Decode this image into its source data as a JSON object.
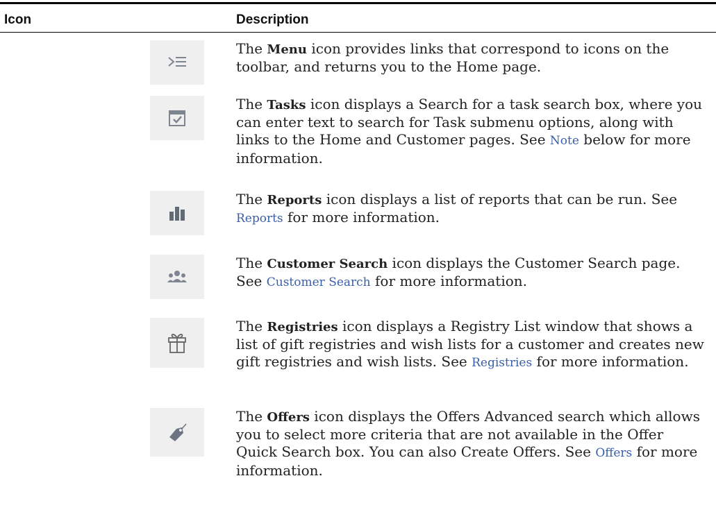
{
  "header": {
    "icon": "Icon",
    "description": "Description"
  },
  "rows": [
    {
      "icon": "menu-icon",
      "pre": "The ",
      "bold": "Menu",
      "text1": " icon provides links that correspond to icons on the toolbar, and returns you to the Home page.",
      "link": "",
      "text2": ""
    },
    {
      "icon": "tasks-icon",
      "pre": "The ",
      "bold": "Tasks",
      "text1": " icon displays a Search for a task search box, where you can enter text to search for Task submenu options, along with links to the Home and Customer pages. See ",
      "link": "Note",
      "text2": " below for more information."
    },
    {
      "icon": "reports-icon",
      "pre": "The ",
      "bold": "Reports",
      "text1": " icon displays a list of reports that can be run. See ",
      "link": "Reports",
      "text2": " for more information."
    },
    {
      "icon": "customer-search-icon",
      "pre": "The ",
      "bold": "Customer Search",
      "text1": " icon displays the Customer Search page. See ",
      "link": "Customer Search",
      "text2": " for more information."
    },
    {
      "icon": "gift-icon",
      "pre": "The ",
      "bold": "Registries",
      "text1": " icon displays a Registry List window that shows a list of gift registries and wish lists for a customer and creates new gift registries and wish lists. See ",
      "link": "Registries",
      "text2": " for more information."
    },
    {
      "icon": "offers-tag-icon",
      "pre": "The ",
      "bold": "Offers",
      "text1": " icon displays the Offers Advanced search which allows you to select more criteria that are not available in the Offer Quick Search box. You can also Create Offers. See ",
      "link": "Offers",
      "text2": " for more information."
    }
  ]
}
